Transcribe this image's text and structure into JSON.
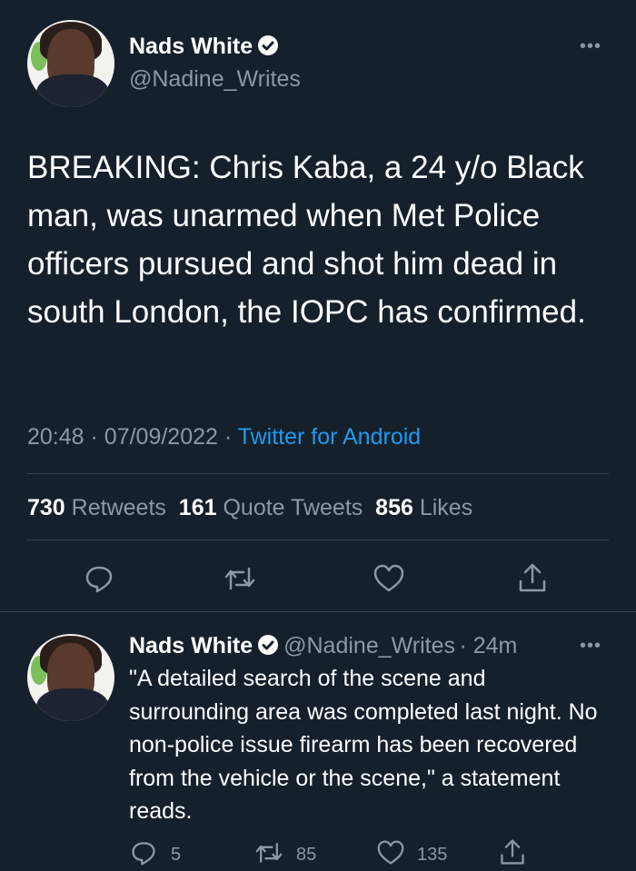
{
  "main_tweet": {
    "author_name": "Nads White",
    "author_handle": "@Nadine_Writes",
    "text": "BREAKING: Chris Kaba, a 24 y/o Black man, was unarmed when Met Police officers pursued and shot him dead in south London, the IOPC has confirmed.",
    "time": "20:48",
    "date": "07/09/2022",
    "source": "Twitter for Android",
    "sep": "·",
    "stats": {
      "retweets_count": "730",
      "retweets_label": "Retweets",
      "quotes_count": "161",
      "quotes_label": "Quote Tweets",
      "likes_count": "856",
      "likes_label": "Likes"
    },
    "more_label": "•••"
  },
  "reply_tweet": {
    "author_name": "Nads White",
    "author_handle": "@Nadine_Writes",
    "age": "· 24m",
    "text": "\"A detailed search of the scene and surrounding area was completed last night. No non-police issue firearm has been recovered from the vehicle or the scene,\" a statement reads.",
    "reply_count": "5",
    "retweet_count": "85",
    "like_count": "135",
    "more_label": "•••"
  },
  "colors": {
    "background": "#15202b",
    "text": "#ffffff",
    "muted": "#8b98a5",
    "link": "#1d9bf0",
    "divider": "#38444d"
  },
  "icons": [
    "verified-badge-icon",
    "more-icon",
    "reply-icon",
    "retweet-icon",
    "like-icon",
    "share-icon"
  ]
}
